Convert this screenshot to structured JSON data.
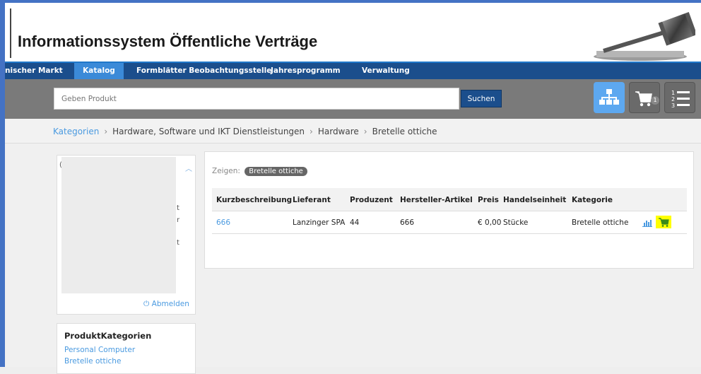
{
  "header": {
    "title": "Informationssystem Öffentliche Verträge"
  },
  "nav": {
    "items": [
      {
        "label": "nischer Markt"
      },
      {
        "label": "Katalog",
        "active": true
      },
      {
        "label": "Formblätter Beobachtungsstelle"
      },
      {
        "label": "Jahresprogramm"
      },
      {
        "label": "Verwaltung"
      }
    ]
  },
  "search": {
    "placeholder": "Geben Produkt",
    "button_label": "Suchen"
  },
  "toolbar": {
    "cart_count": "1"
  },
  "breadcrumb": {
    "items": [
      "Kategorien",
      "Hardware, Software und IKT Dienstleistungen",
      "Hardware",
      "Bretelle ottiche"
    ]
  },
  "sidebar": {
    "fragments": [
      "(",
      "t",
      "r",
      "t"
    ],
    "logout_label": "Abmelden",
    "categories": {
      "heading": "ProduktKategorien",
      "items": [
        "Personal Computer",
        "Bretelle ottiche"
      ]
    }
  },
  "results": {
    "filter_label": "Zeigen:",
    "filter_tag": "Bretelle ottiche",
    "columns": [
      "Kurzbeschreibung",
      "Lieferant",
      "Produzent",
      "Hersteller-Artikel",
      "Preis",
      "Handelseinheit",
      "Kategorie"
    ],
    "rows": [
      {
        "kurzbeschreibung": "666",
        "lieferant": "Lanzinger SPA",
        "produzent": "44",
        "hersteller_artikel": "666",
        "preis": "€ 0,00",
        "handelseinheit": "Stücke",
        "kategorie": "Bretelle ottiche"
      }
    ]
  },
  "colors": {
    "nav_bg": "#1b4e8c",
    "nav_active": "#3b8ad8",
    "link": "#4a9ae0",
    "toolbar_blue": "#5da8f0",
    "cart_highlight": "#ffff00"
  }
}
